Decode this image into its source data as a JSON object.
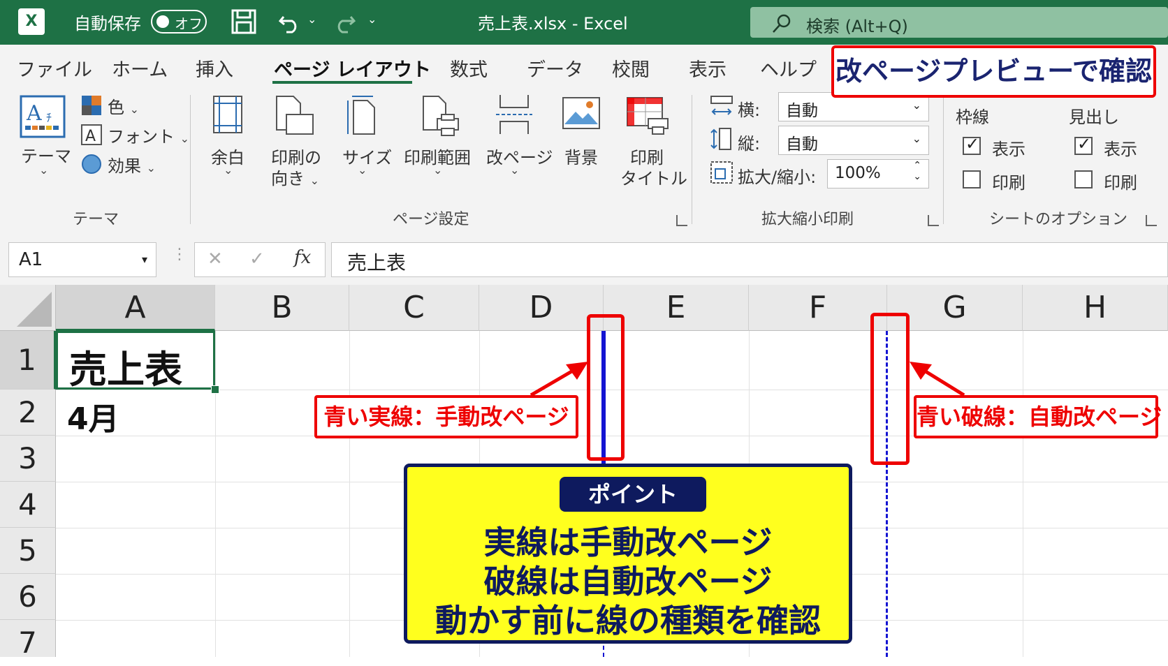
{
  "window": {
    "autosave_label": "自動保存",
    "autosave_state": "オフ",
    "title": "売上表.xlsx  -  Excel",
    "search_placeholder": "検索 (Alt+Q)"
  },
  "ribbon_tabs": [
    "ファイル",
    "ホーム",
    "挿入",
    "ページ レイアウト",
    "数式",
    "データ",
    "校閲",
    "表示",
    "ヘルプ"
  ],
  "active_tab": "ページ レイアウト",
  "callout_preview": "改ページプレビューで確認",
  "groups": {
    "theme": {
      "label": "テーマ",
      "theme_button": "テーマ",
      "colors": "色",
      "fonts": "フォント",
      "effects": "効果"
    },
    "page_setup": {
      "label": "ページ設定",
      "margins": "余白",
      "orientation_1": "印刷の",
      "orientation_2": "向き",
      "size": "サイズ",
      "print_area": "印刷範囲",
      "breaks": "改ページ",
      "background": "背景",
      "print_titles_1": "印刷",
      "print_titles_2": "タイトル"
    },
    "scale": {
      "label": "拡大縮小印刷",
      "width_label": "横:",
      "width_value": "自動",
      "height_label": "縦:",
      "height_value": "自動",
      "scale_label": "拡大/縮小:",
      "scale_value": "100%"
    },
    "sheet_options": {
      "label": "シートのオプション",
      "gridlines": "枠線",
      "headings": "見出し",
      "view": "表示",
      "print": "印刷",
      "gridlines_view_checked": true,
      "gridlines_print_checked": false,
      "headings_view_checked": true,
      "headings_print_checked": false
    }
  },
  "formula_bar": {
    "name_box": "A1",
    "cancel": "✕",
    "enter": "✓",
    "fx": "fx",
    "content": "売上表"
  },
  "sheet": {
    "columns": [
      "A",
      "B",
      "C",
      "D",
      "E",
      "F",
      "G",
      "H"
    ],
    "rows": [
      "1",
      "2",
      "3",
      "4",
      "5",
      "6",
      "7"
    ],
    "cells": {
      "A1": "売上表",
      "A2": "4月"
    }
  },
  "annotations": {
    "solid_label": "青い実線：手動改ページ",
    "dashed_label": "青い破線：自動改ページ",
    "point_badge": "ポイント",
    "point_lines": [
      "実線は手動改ページ",
      "破線は自動改ページ",
      "動かす前に線の種類を確認"
    ]
  },
  "colors": {
    "excel_green": "#1e7145",
    "callout_red": "#ee0000",
    "page_break_blue": "#1414d2",
    "point_yellow": "#ffff1e",
    "point_navy": "#0e1a5e"
  }
}
